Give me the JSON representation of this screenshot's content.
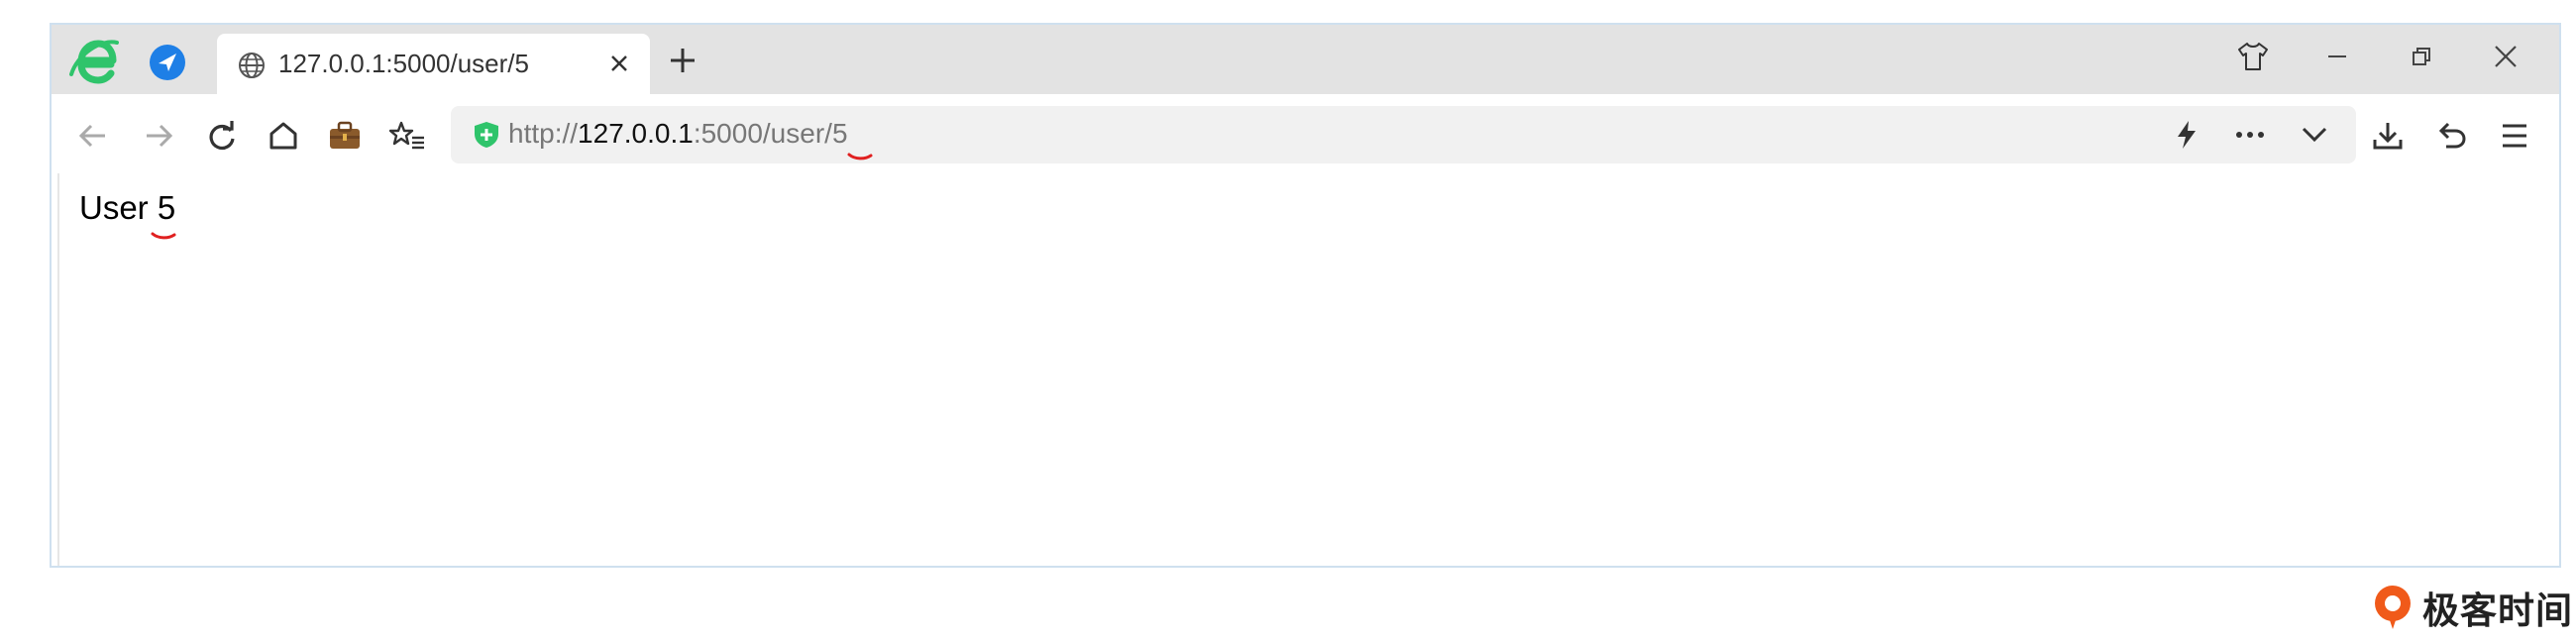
{
  "tab": {
    "title": "127.0.0.1:5000/user/5"
  },
  "address_bar": {
    "scheme": "http://",
    "host": "127.0.0.1",
    "path": ":5000/user/",
    "highlight": "5"
  },
  "page": {
    "label": "User ",
    "user_id": "5"
  },
  "watermark": {
    "text": "极客时间"
  },
  "icons": {
    "browser_logo": "ie-e-logo-icon",
    "extension": "compass-icon",
    "tab": "globe-icon",
    "security": "shield-check-icon"
  },
  "colors": {
    "logo_green": "#2fc46b",
    "highlight_red": "#e02020",
    "accent_blue": "#1e7fe6",
    "watermark_orange": "#f05a1a"
  }
}
